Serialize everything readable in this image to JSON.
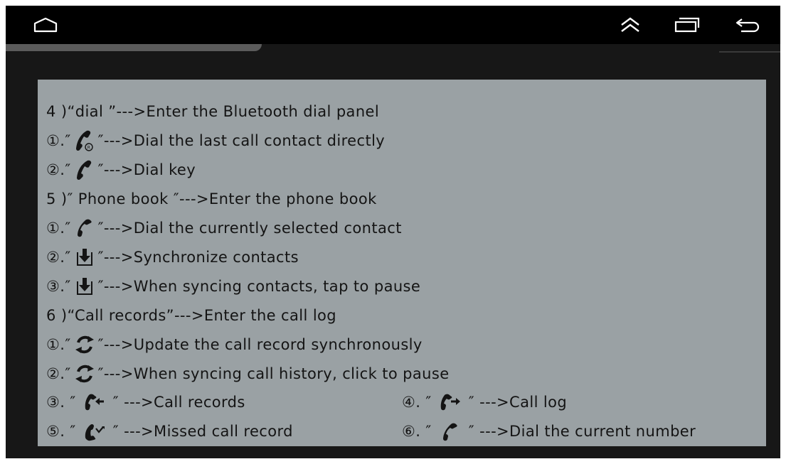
{
  "nav": {
    "home_icon": "home-outline-icon",
    "up_icon": "double-chevron-up-icon",
    "recents_icon": "recent-apps-icon",
    "back_icon": "back-arrow-icon"
  },
  "colors": {
    "screen_bg": "#171717",
    "statusbar_bg": "#000000",
    "panel_bg": "#9aa1a4",
    "text": "#141414"
  },
  "lines": [
    {
      "num": "4 )",
      "q1": " “dial ” ",
      "text": "--->Enter the Bluetooth dial panel"
    },
    {
      "num": "①.",
      "q1": " ″",
      "icon": "phone-redial-icon",
      "q2": "″ ",
      "text": "--->Dial the last call contact directly"
    },
    {
      "num": "②.",
      "q1": " ″",
      "icon": "phone-dial-icon",
      "q2": "″ ",
      "text": "--->Dial key"
    },
    {
      "num": "5 )",
      "q1": " ″ Phone book ″ ",
      "text": "--->Enter the phone book"
    },
    {
      "num": "①.",
      "q1": " ″",
      "icon": "phone-handset-icon",
      "q2": "″ ",
      "text": "--->Dial the currently selected contact"
    },
    {
      "num": "②.",
      "q1": " ″",
      "icon": "download-sync-icon",
      "q2": "″ ",
      "text": "--->Synchronize contacts"
    },
    {
      "num": "③.",
      "q1": " ″",
      "icon": "download-sync-icon",
      "q2": "″ ",
      "text": "--->When syncing contacts, tap to pause"
    },
    {
      "num": "6 )",
      "q1": " “Call records” ",
      "text": "--->Enter the call log"
    },
    {
      "num": "①.",
      "q1": " ″",
      "icon": "refresh-icon",
      "q2": "″ ",
      "text": "--->Update the call record synchronously"
    },
    {
      "num": "②.",
      "q1": " ″",
      "icon": "refresh-icon",
      "q2": "″ ",
      "text": "--->When syncing call history, click to pause"
    }
  ],
  "pair_lines": [
    {
      "left": {
        "num": "③.",
        "q1": " ″",
        "icon": "incoming-call-icon",
        "q2": "″ ",
        "text": "--->Call records"
      },
      "right": {
        "num": "④.",
        "q1": " ″",
        "icon": "outgoing-call-icon",
        "q2": "″ ",
        "text": "--->Call log"
      }
    },
    {
      "left": {
        "num": "⑤.",
        "q1": " ″",
        "icon": "missed-call-icon",
        "q2": "″ ",
        "text": "--->Missed call record"
      },
      "right": {
        "num": "⑥.",
        "q1": " ″",
        "icon": "phone-handset-icon",
        "q2": "″ ",
        "text": "--->Dial the current number"
      }
    }
  ]
}
